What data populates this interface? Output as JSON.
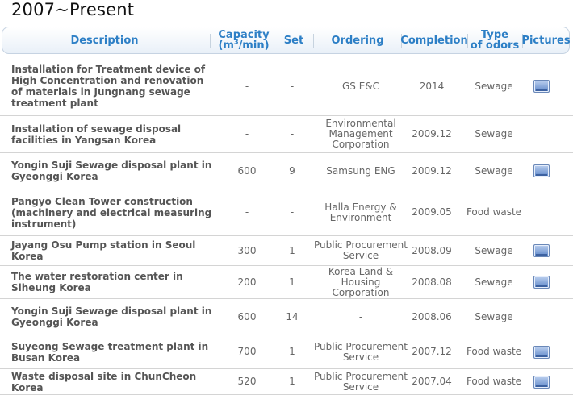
{
  "page_title": "2007~Present",
  "columns": {
    "description": "Description",
    "capacity": "Capacity",
    "capacity_unit_pre": "(m",
    "capacity_unit_sup": "3",
    "capacity_unit_post": "/min)",
    "set": "Set",
    "ordering": "Ordering",
    "completion": "Completion",
    "type_line1": "Type",
    "type_line2": "of odors",
    "pictures": "Pictures"
  },
  "rows": [
    {
      "description": "Installation for Treatment device of High Concentration and renovation of materials in Jungnang sewage treatment plant",
      "capacity": "-",
      "set": "-",
      "ordering": "GS E&C",
      "completion": "2014",
      "odor": "Sewage",
      "has_picture": true,
      "picture_icon": "picture-icon"
    },
    {
      "description": "Installation of sewage disposal facilities in Yangsan Korea",
      "capacity": "-",
      "set": "-",
      "ordering": "Environmental Management Corporation",
      "completion": "2009.12",
      "odor": "Sewage",
      "has_picture": false
    },
    {
      "description": "Yongin Suji Sewage disposal plant in Gyeonggi Korea",
      "capacity": "600",
      "set": "9",
      "ordering": "Samsung ENG",
      "completion": "2009.12",
      "odor": "Sewage",
      "has_picture": true,
      "picture_icon": "picture-icon"
    },
    {
      "description": "Pangyo  Clean Tower  construction (machinery and electrical measuring instrument)",
      "capacity": "-",
      "set": "-",
      "ordering": "Halla Energy & Environment",
      "completion": "2009.05",
      "odor": "Food waste",
      "has_picture": false
    },
    {
      "description": "Jayang Osu Pump station in Seoul Korea",
      "capacity": "300",
      "set": "1",
      "ordering": "Public Procurement Service",
      "completion": "2008.09",
      "odor": "Sewage",
      "has_picture": true,
      "picture_icon": "picture-icon"
    },
    {
      "description": "The water restoration center in Siheung Korea",
      "capacity": "200",
      "set": "1",
      "ordering": "Korea Land & Housing Corporation",
      "completion": "2008.08",
      "odor": "Sewage",
      "has_picture": true,
      "picture_icon": "picture-icon"
    },
    {
      "description": "Yongin Suji Sewage disposal plant in Gyeonggi Korea",
      "capacity": "600",
      "set": "14",
      "ordering": "-",
      "completion": "2008.06",
      "odor": "Sewage",
      "has_picture": false
    },
    {
      "description": "Suyeong Sewage treatment plant in Busan Korea",
      "capacity": "700",
      "set": "1",
      "ordering": "Public Procurement Service",
      "completion": "2007.12",
      "odor": "Food waste",
      "has_picture": true,
      "picture_icon": "picture-icon"
    },
    {
      "description": "Waste disposal site in ChunCheon Korea",
      "capacity": "520",
      "set": "1",
      "ordering": "Public Procurement Service",
      "completion": "2007.04",
      "odor": "Food waste",
      "has_picture": true,
      "picture_icon": "picture-icon"
    }
  ]
}
